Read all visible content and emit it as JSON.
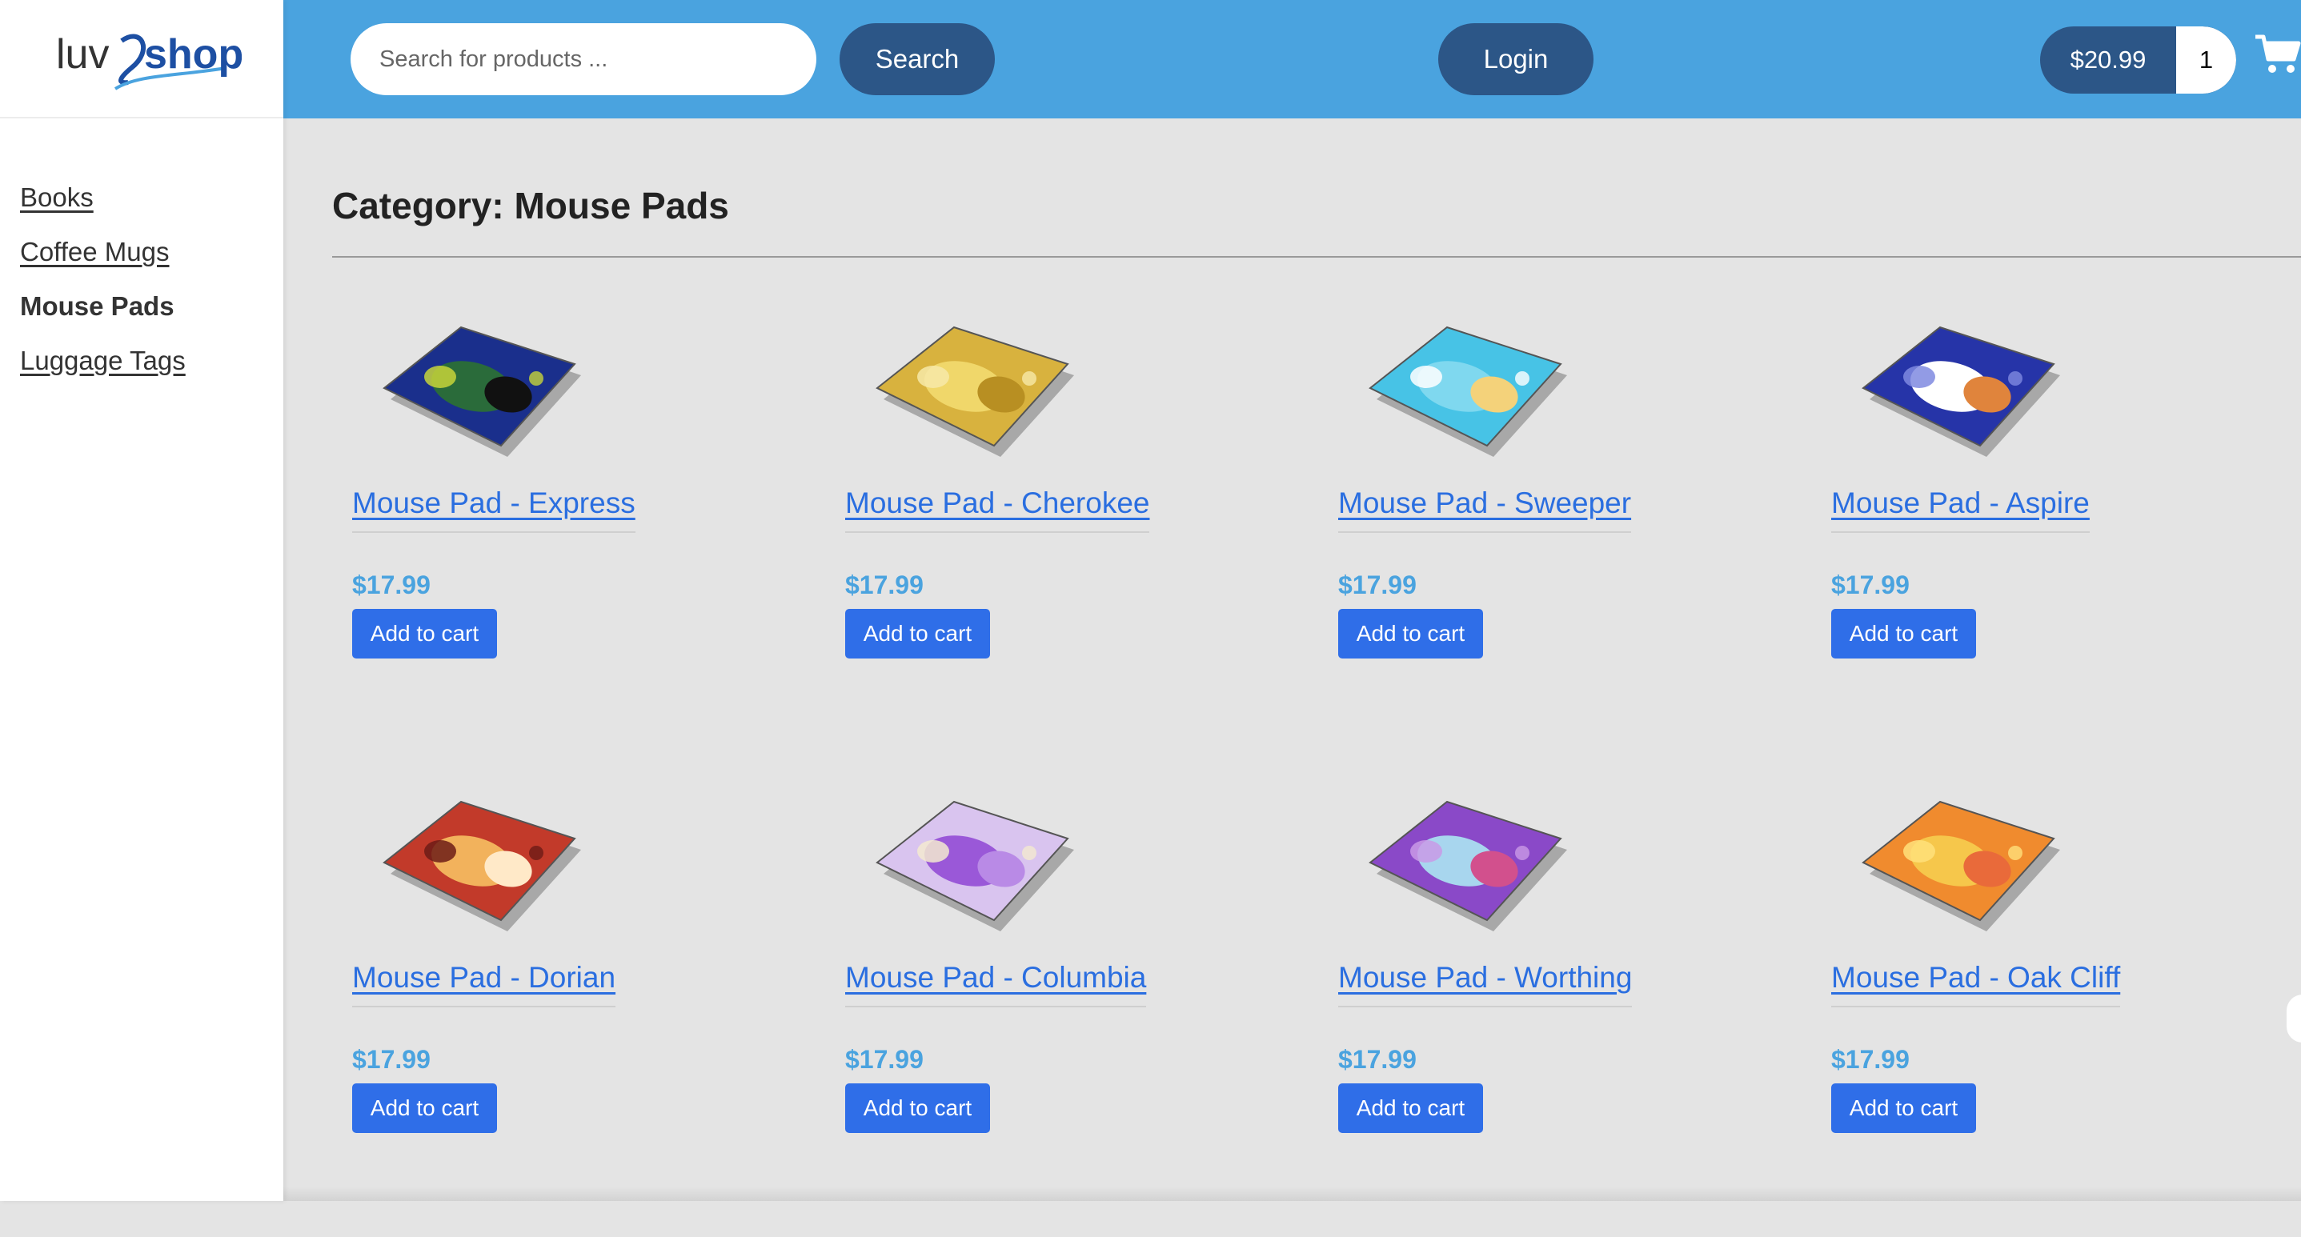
{
  "brand": {
    "logo_text_1": "luv",
    "logo_text_2": "shop"
  },
  "sidebar": {
    "items": [
      {
        "label": "Books",
        "active": false
      },
      {
        "label": "Coffee Mugs",
        "active": false
      },
      {
        "label": "Mouse Pads",
        "active": true
      },
      {
        "label": "Luggage Tags",
        "active": false
      }
    ]
  },
  "header": {
    "search_placeholder": "Search for products ...",
    "search_label": "Search",
    "login_label": "Login",
    "cart_total": "$20.99",
    "cart_qty": "1",
    "colors": {
      "bar": "#4aa3df",
      "pill": "#2c5687"
    }
  },
  "main": {
    "title": "Category: Mouse Pads",
    "products": [
      {
        "name": "Mouse Pad - Express",
        "price": "$17.99",
        "button": "Add to cart",
        "palette": "express"
      },
      {
        "name": "Mouse Pad - Cherokee",
        "price": "$17.99",
        "button": "Add to cart",
        "palette": "cherokee"
      },
      {
        "name": "Mouse Pad - Sweeper",
        "price": "$17.99",
        "button": "Add to cart",
        "palette": "sweeper"
      },
      {
        "name": "Mouse Pad - Aspire",
        "price": "$17.99",
        "button": "Add to cart",
        "palette": "aspire"
      },
      {
        "name": "Mouse Pad - Dorian",
        "price": "$17.99",
        "button": "Add to cart",
        "palette": "dorian"
      },
      {
        "name": "Mouse Pad - Columbia",
        "price": "$17.99",
        "button": "Add to cart",
        "palette": "columbia"
      },
      {
        "name": "Mouse Pad - Worthing",
        "price": "$17.99",
        "button": "Add to cart",
        "palette": "worthing"
      },
      {
        "name": "Mouse Pad - Oak Cliff",
        "price": "$17.99",
        "button": "Add to cart",
        "palette": "oakcliff"
      }
    ]
  }
}
